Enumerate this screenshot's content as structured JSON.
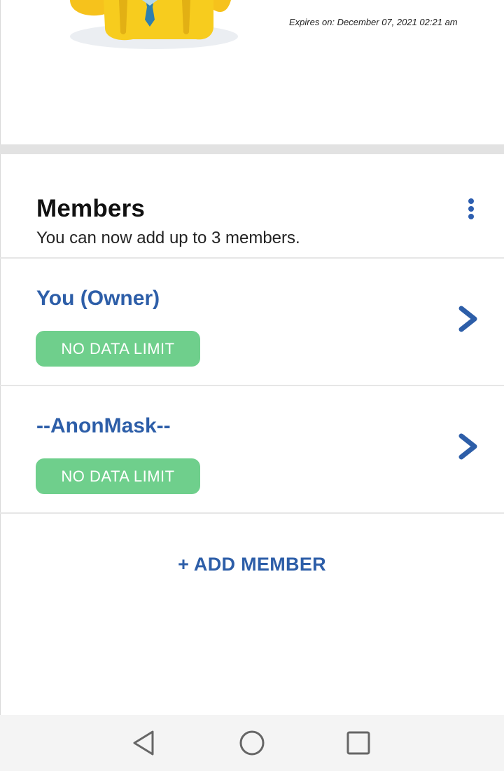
{
  "plan": {
    "expires_text": "Expires on: December 07, 2021 02:21 am"
  },
  "members_section": {
    "title": "Members",
    "subtitle": "You can now add up to 3 members.",
    "menu_icon": "more-vertical-icon"
  },
  "members": [
    {
      "name": "You (Owner)",
      "badge": "NO DATA LIMIT",
      "icon": "chevron-right-icon"
    },
    {
      "name": "--AnonMask--",
      "badge": "NO DATA LIMIT",
      "icon": "chevron-right-icon"
    }
  ],
  "add_member_label": "+ ADD MEMBER",
  "nav_bar": {
    "back_icon": "triangle-back-icon",
    "home_icon": "circle-home-icon",
    "recents_icon": "square-recents-icon"
  },
  "colors": {
    "accent": "#2d5ea8",
    "badge_bg": "#6fcf8c",
    "divider": "#e2e2e2"
  }
}
